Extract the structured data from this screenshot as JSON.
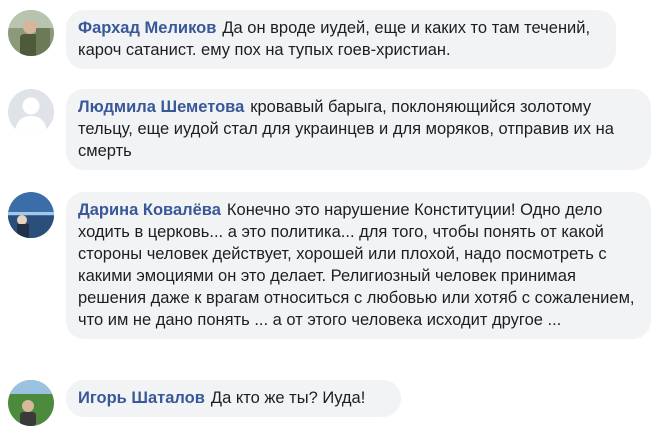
{
  "comments": [
    {
      "author": "Фархад Меликов",
      "text": "Да он вроде иудей, еще и каких то там течений, кароч сатанист. ему пох на тупых гоев-христиан.",
      "avatar_icon": "user-photo-icon"
    },
    {
      "author": "Людмила Шеметова",
      "text": "кровавый барыга, поклоняющийся золотому тельцу, еще иудой стал для украинцев и для моряков, отправив их на смерть",
      "avatar_icon": "default-avatar-icon"
    },
    {
      "author": "Дарина Ковалёва",
      "text": "Конечно это нарушение Конституции! Одно дело ходить в церковь... а это политика... для того, чтобы понять от какой стороны человек действует, хорошей или плохой, надо посмотреть с какими эмоциями он это делает. Религиозный человек принимая решения даже к врагам относиться с любовью или хотяб с сожалением, что им не дано понять ... а от этого человека исходит другое ...",
      "avatar_icon": "user-photo-icon"
    },
    {
      "author": "Игорь Шаталов",
      "text": "Да кто же ты? Иуда!",
      "avatar_icon": "user-photo-icon"
    }
  ],
  "colors": {
    "author": "#385898",
    "bubble": "#f2f3f5",
    "text": "#1c1e21"
  }
}
